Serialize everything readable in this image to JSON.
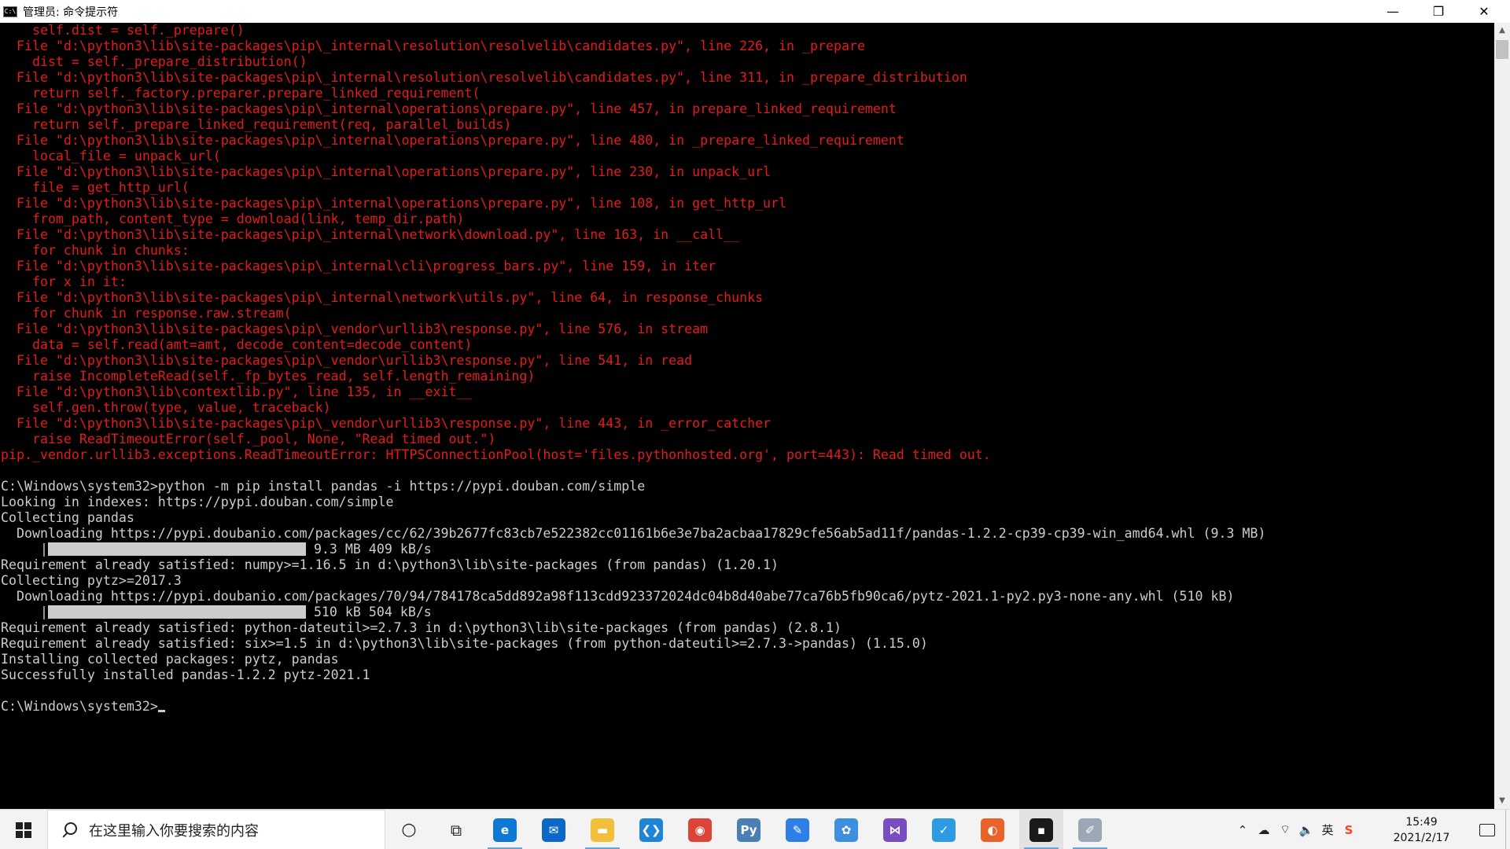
{
  "window": {
    "title": "管理员: 命令提示符",
    "icon_text": "C:\\",
    "minimize": "—",
    "restore": "❐",
    "close": "✕"
  },
  "console_lines": [
    {
      "type": "err",
      "text": "    self.dist = self._prepare()"
    },
    {
      "type": "err",
      "text": "  File \"d:\\python3\\lib\\site-packages\\pip\\_internal\\resolution\\resolvelib\\candidates.py\", line 226, in _prepare"
    },
    {
      "type": "err",
      "text": "    dist = self._prepare_distribution()"
    },
    {
      "type": "err",
      "text": "  File \"d:\\python3\\lib\\site-packages\\pip\\_internal\\resolution\\resolvelib\\candidates.py\", line 311, in _prepare_distribution"
    },
    {
      "type": "err",
      "text": "    return self._factory.preparer.prepare_linked_requirement("
    },
    {
      "type": "err",
      "text": "  File \"d:\\python3\\lib\\site-packages\\pip\\_internal\\operations\\prepare.py\", line 457, in prepare_linked_requirement"
    },
    {
      "type": "err",
      "text": "    return self._prepare_linked_requirement(req, parallel_builds)"
    },
    {
      "type": "err",
      "text": "  File \"d:\\python3\\lib\\site-packages\\pip\\_internal\\operations\\prepare.py\", line 480, in _prepare_linked_requirement"
    },
    {
      "type": "err",
      "text": "    local_file = unpack_url("
    },
    {
      "type": "err",
      "text": "  File \"d:\\python3\\lib\\site-packages\\pip\\_internal\\operations\\prepare.py\", line 230, in unpack_url"
    },
    {
      "type": "err",
      "text": "    file = get_http_url("
    },
    {
      "type": "err",
      "text": "  File \"d:\\python3\\lib\\site-packages\\pip\\_internal\\operations\\prepare.py\", line 108, in get_http_url"
    },
    {
      "type": "err",
      "text": "    from_path, content_type = download(link, temp_dir.path)"
    },
    {
      "type": "err",
      "text": "  File \"d:\\python3\\lib\\site-packages\\pip\\_internal\\network\\download.py\", line 163, in __call__"
    },
    {
      "type": "err",
      "text": "    for chunk in chunks:"
    },
    {
      "type": "err",
      "text": "  File \"d:\\python3\\lib\\site-packages\\pip\\_internal\\cli\\progress_bars.py\", line 159, in iter"
    },
    {
      "type": "err",
      "text": "    for x in it:"
    },
    {
      "type": "err",
      "text": "  File \"d:\\python3\\lib\\site-packages\\pip\\_internal\\network\\utils.py\", line 64, in response_chunks"
    },
    {
      "type": "err",
      "text": "    for chunk in response.raw.stream("
    },
    {
      "type": "err",
      "text": "  File \"d:\\python3\\lib\\site-packages\\pip\\_vendor\\urllib3\\response.py\", line 576, in stream"
    },
    {
      "type": "err",
      "text": "    data = self.read(amt=amt, decode_content=decode_content)"
    },
    {
      "type": "err",
      "text": "  File \"d:\\python3\\lib\\site-packages\\pip\\_vendor\\urllib3\\response.py\", line 541, in read"
    },
    {
      "type": "err",
      "text": "    raise IncompleteRead(self._fp_bytes_read, self.length_remaining)"
    },
    {
      "type": "err",
      "text": "  File \"d:\\python3\\lib\\contextlib.py\", line 135, in __exit__"
    },
    {
      "type": "err",
      "text": "    self.gen.throw(type, value, traceback)"
    },
    {
      "type": "err",
      "text": "  File \"d:\\python3\\lib\\site-packages\\pip\\_vendor\\urllib3\\response.py\", line 443, in _error_catcher"
    },
    {
      "type": "err",
      "text": "    raise ReadTimeoutError(self._pool, None, \"Read timed out.\")"
    },
    {
      "type": "err",
      "text": "pip._vendor.urllib3.exceptions.ReadTimeoutError: HTTPSConnectionPool(host='files.pythonhosted.org', port=443): Read timed out."
    },
    {
      "type": "out",
      "text": ""
    },
    {
      "type": "out",
      "text": "C:\\Windows\\system32>python -m pip install pandas -i https://pypi.douban.com/simple"
    },
    {
      "type": "out",
      "text": "Looking in indexes: https://pypi.douban.com/simple"
    },
    {
      "type": "out",
      "text": "Collecting pandas"
    },
    {
      "type": "out",
      "text": "  Downloading https://pypi.doubanio.com/packages/cc/62/39b2677fc83cb7e522382cc01161b6e3e7ba2acbaa17829cfe56ab5ad11f/pandas-1.2.2-cp39-cp39-win_amd64.whl (9.3 MB)"
    },
    {
      "type": "bar",
      "prefix": "     |",
      "text": " 9.3 MB 409 kB/s"
    },
    {
      "type": "out",
      "text": "Requirement already satisfied: numpy>=1.16.5 in d:\\python3\\lib\\site-packages (from pandas) (1.20.1)"
    },
    {
      "type": "out",
      "text": "Collecting pytz>=2017.3"
    },
    {
      "type": "out",
      "text": "  Downloading https://pypi.doubanio.com/packages/70/94/784178ca5dd892a98f113cdd923372024dc04b8d40abe77ca76b5fb90ca6/pytz-2021.1-py2.py3-none-any.whl (510 kB)"
    },
    {
      "type": "bar",
      "prefix": "     |",
      "text": " 510 kB 504 kB/s"
    },
    {
      "type": "out",
      "text": "Requirement already satisfied: python-dateutil>=2.7.3 in d:\\python3\\lib\\site-packages (from pandas) (2.8.1)"
    },
    {
      "type": "out",
      "text": "Requirement already satisfied: six>=1.5 in d:\\python3\\lib\\site-packages (from python-dateutil>=2.7.3->pandas) (1.15.0)"
    },
    {
      "type": "out",
      "text": "Installing collected packages: pytz, pandas"
    },
    {
      "type": "out",
      "text": "Successfully installed pandas-1.2.2 pytz-2021.1"
    },
    {
      "type": "out",
      "text": ""
    },
    {
      "type": "prompt",
      "text": "C:\\Windows\\system32>"
    }
  ],
  "scrollbar": {
    "up": "▲",
    "down": "▼"
  },
  "taskbar": {
    "search_placeholder": "在这里输入你要搜索的内容",
    "cortana_glyph": "○",
    "taskview_glyph": "⧉",
    "apps": [
      {
        "name": "edge-app-icon",
        "glyph": "e",
        "color": "#0f78d4",
        "running": true,
        "active": false
      },
      {
        "name": "mail-app-icon",
        "glyph": "✉",
        "color": "#0b68c6",
        "running": false,
        "active": false
      },
      {
        "name": "file-explorer-icon",
        "glyph": "▬",
        "color": "#f2bf3a",
        "running": true,
        "active": false
      },
      {
        "name": "vscode-app-icon",
        "glyph": "❮❯",
        "color": "#1f84d8",
        "running": false,
        "active": false
      },
      {
        "name": "chrome-app-icon",
        "glyph": "◉",
        "color": "#db4437",
        "running": false,
        "active": false
      },
      {
        "name": "python-file-icon",
        "glyph": "Py",
        "color": "#4a7fb5",
        "running": false,
        "active": false
      },
      {
        "name": "notes-app-icon",
        "glyph": "✎",
        "color": "#2f7fe8",
        "running": false,
        "active": false
      },
      {
        "name": "network-app-icon",
        "glyph": "✿",
        "color": "#3d8fe0",
        "running": false,
        "active": false
      },
      {
        "name": "visual-studio-icon",
        "glyph": "⋈",
        "color": "#7a4cc2",
        "running": false,
        "active": false
      },
      {
        "name": "check-app-icon",
        "glyph": "✓",
        "color": "#2d9be3",
        "running": false,
        "active": false
      },
      {
        "name": "firefox-app-icon",
        "glyph": "◐",
        "color": "#e8622a",
        "running": false,
        "active": false
      },
      {
        "name": "cmd-app-icon",
        "glyph": "▪",
        "color": "#1a1a1a",
        "running": true,
        "active": true
      },
      {
        "name": "paint-app-icon",
        "glyph": "✐",
        "color": "#9aa7b4",
        "running": true,
        "active": false
      }
    ],
    "tray": [
      {
        "name": "tray-chevron-icon",
        "glyph": "⌃"
      },
      {
        "name": "onedrive-icon",
        "glyph": "☁"
      },
      {
        "name": "wifi-icon",
        "glyph": "⌔"
      },
      {
        "name": "volume-icon",
        "glyph": "🔈"
      },
      {
        "name": "ime-icon",
        "glyph": "英"
      },
      {
        "name": "sogou-icon",
        "glyph": "S"
      }
    ],
    "time": "15:49",
    "date": "2021/2/17"
  }
}
